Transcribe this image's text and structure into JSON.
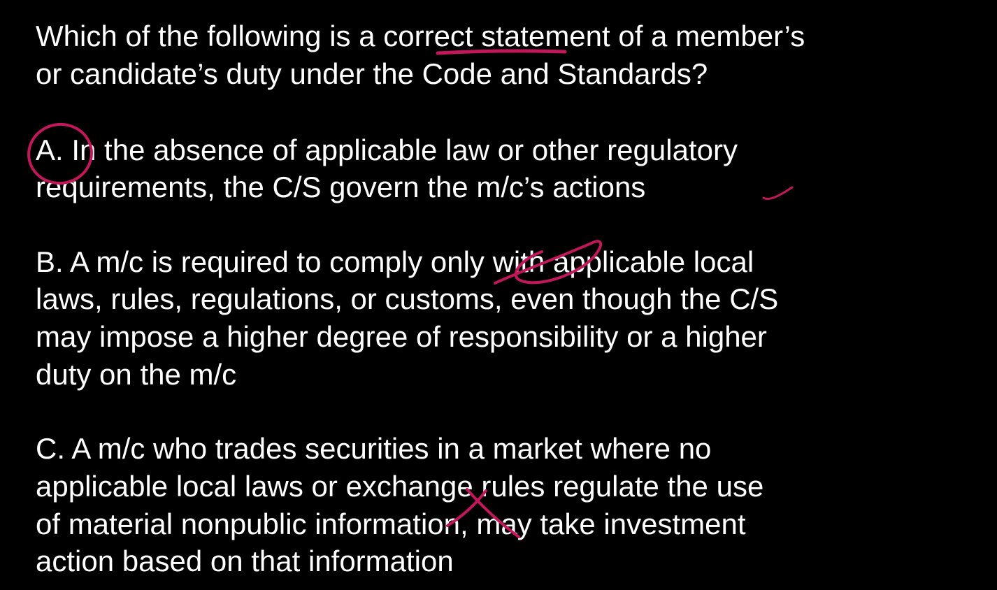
{
  "question": {
    "lines": [
      "Which of the following is a correct statement of a member’s",
      "or candidate’s duty under the Code and Standards?"
    ]
  },
  "options": [
    {
      "letter": "A",
      "lines": [
        "A.  In the absence of applicable law or other regulatory",
        "requirements, the C/S govern the m/c’s actions"
      ]
    },
    {
      "letter": "B",
      "lines": [
        "B.  A m/c is required to comply only with applicable local",
        "laws, rules, regulations, or customs, even though the C/S",
        "may impose a higher degree of responsibility or a higher",
        "duty on the m/c"
      ]
    },
    {
      "letter": "C",
      "lines": [
        "C.  A m/c who trades securities in a market where no",
        "applicable local laws or exchange rules regulate the use",
        "of material nonpublic information, may take investment",
        "action based on that information"
      ]
    }
  ],
  "colors": {
    "background": "#000000",
    "text": "#ffffff",
    "ink": "#c2185b"
  }
}
